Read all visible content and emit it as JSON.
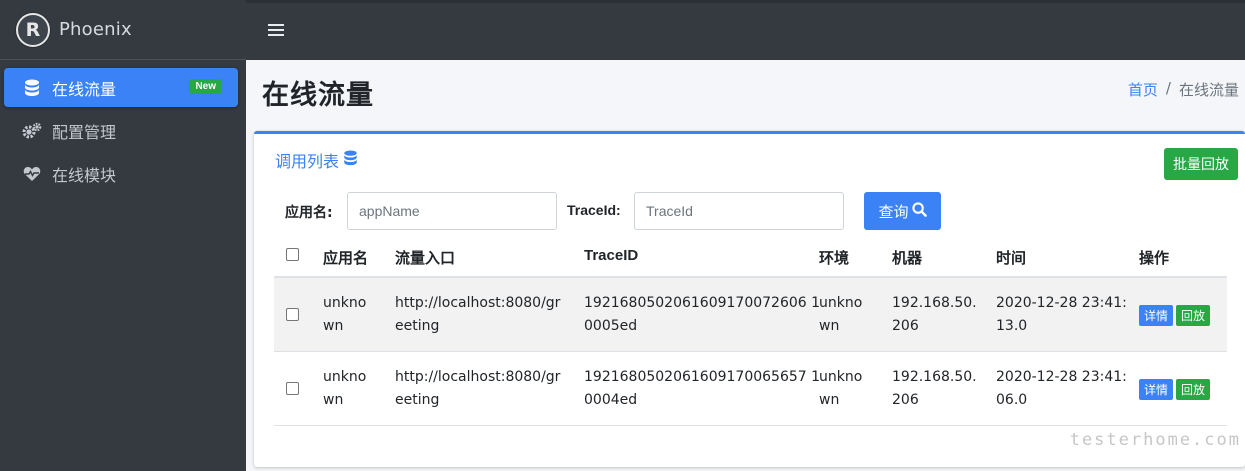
{
  "brand": {
    "logo_letter": "R",
    "name": "Phoenix"
  },
  "sidebar": {
    "items": [
      {
        "label": "在线流量",
        "icon": "database-icon",
        "badge": "New",
        "active": true
      },
      {
        "label": "配置管理",
        "icon": "gears-icon"
      },
      {
        "label": "在线模块",
        "icon": "heartbeat-icon"
      }
    ]
  },
  "header": {
    "title": "在线流量",
    "breadcrumb": {
      "home": "首页",
      "separator": "/",
      "current": "在线流量"
    }
  },
  "card": {
    "title": "调用列表",
    "batch_replay_label": "批量回放",
    "filters": {
      "app_label": "应用名:",
      "app_placeholder": "appName",
      "trace_label": "TraceId:",
      "trace_placeholder": "TraceId",
      "query_label": "查询"
    },
    "table": {
      "headers": [
        "应用名",
        "流量入口",
        "TraceID",
        "环境",
        "机器",
        "时间",
        "操作"
      ],
      "rows": [
        {
          "app": [
            "unkno",
            "wn"
          ],
          "entry": [
            "http://localhost:8080/gr",
            "eeting"
          ],
          "trace": [
            "1921680502061609170072606 1",
            "0005ed"
          ],
          "env": [
            "unkno",
            "wn"
          ],
          "host": [
            "192.168.50.",
            "206"
          ],
          "time": [
            "2020-12-28 23:41:",
            "13.0"
          ],
          "detail": "详情",
          "replay": "回放"
        },
        {
          "app": [
            "unkno",
            "wn"
          ],
          "entry": [
            "http://localhost:8080/gr",
            "eeting"
          ],
          "trace": [
            "1921680502061609170065657 1",
            "0004ed"
          ],
          "env": [
            "unkno",
            "wn"
          ],
          "host": [
            "192.168.50.",
            "206"
          ],
          "time": [
            "2020-12-28 23:41:",
            "06.0"
          ],
          "detail": "详情",
          "replay": "回放"
        }
      ]
    }
  },
  "watermark": "testerhome.com",
  "colors": {
    "primary": "#3b82f6",
    "success": "#28a745",
    "sidebar": "#343a40"
  }
}
